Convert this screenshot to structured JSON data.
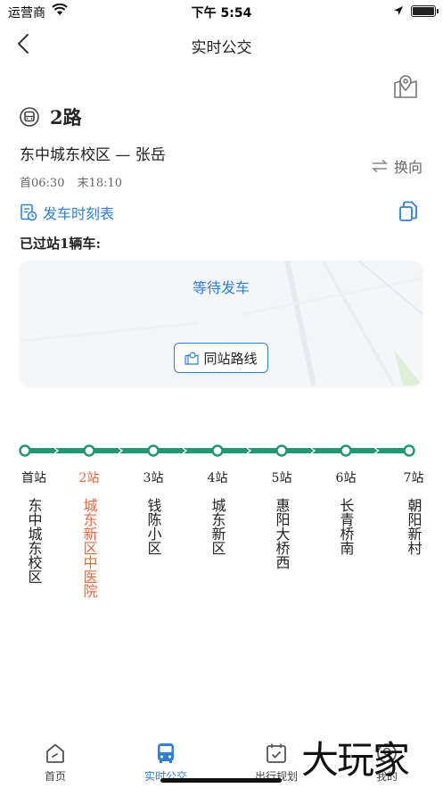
{
  "status_bar": {
    "carrier": "运营商",
    "time": "下午 5:54"
  },
  "nav": {
    "title": "实时公交"
  },
  "route": {
    "name": "2路",
    "direction": "东中城东校区 — 张岳",
    "first_bus": "首06:30",
    "last_bus": "末18:10",
    "swap_label": "换向",
    "schedule_label": "发车时刻表",
    "passed_label": "已过站1辆车:"
  },
  "card": {
    "status": "等待发车",
    "same_station_label": "同站路线"
  },
  "stops": [
    {
      "num": "首站",
      "name": "东中城东校区",
      "active": false
    },
    {
      "num": "2站",
      "name": "城东新区中医院",
      "active": true
    },
    {
      "num": "3站",
      "name": "钱陈小区",
      "active": false
    },
    {
      "num": "4站",
      "name": "城东新区",
      "active": false
    },
    {
      "num": "5站",
      "name": "惠阳大桥西",
      "active": false
    },
    {
      "num": "6站",
      "name": "长青桥南",
      "active": false
    },
    {
      "num": "7站",
      "name": "朝阳新村",
      "active": false
    }
  ],
  "colors": {
    "accent": "#2f7fd6",
    "line": "#1f9a6e",
    "active_stop": "#e8693d"
  },
  "tabs": [
    {
      "label": "首页",
      "icon": "home-icon",
      "active": false
    },
    {
      "label": "实时公交",
      "icon": "bus-icon",
      "active": true
    },
    {
      "label": "出行规划",
      "icon": "calendar-icon",
      "active": false
    },
    {
      "label": "我的",
      "icon": "user-icon",
      "active": false
    }
  ],
  "watermark": "大玩家"
}
